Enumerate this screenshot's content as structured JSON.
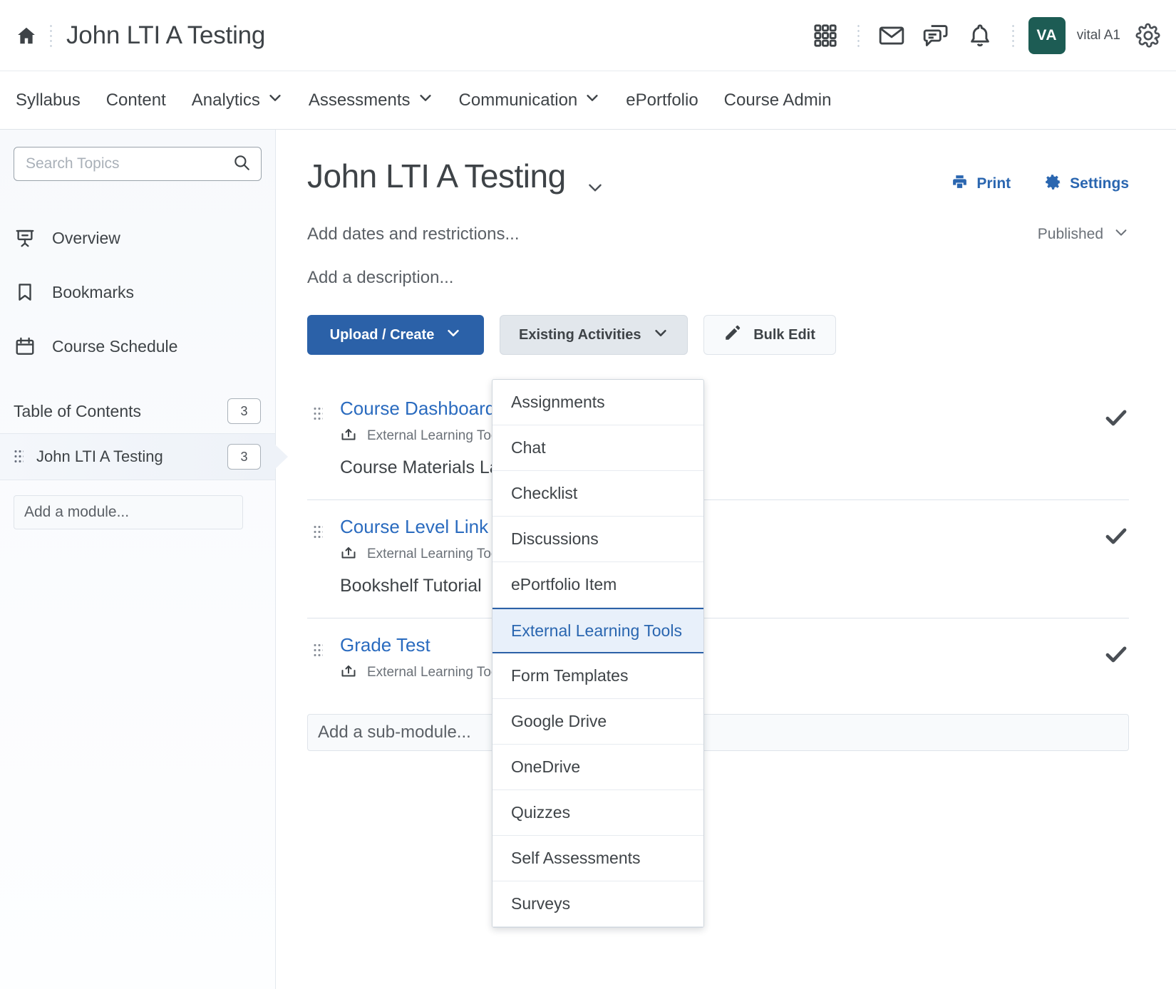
{
  "topbar": {
    "home_icon": "home-icon",
    "title": "John LTI A Testing",
    "icons": [
      {
        "name": "waffle-grid-icon"
      },
      {
        "name": "email-icon"
      },
      {
        "name": "message-icon"
      },
      {
        "name": "bell-icon"
      }
    ],
    "avatar_initials": "VA",
    "username": "vital A1",
    "settings_icon": "gear-icon"
  },
  "nav": {
    "items": [
      {
        "label": "Syllabus",
        "has_chevron": false
      },
      {
        "label": "Content",
        "has_chevron": false
      },
      {
        "label": "Analytics",
        "has_chevron": true
      },
      {
        "label": "Assessments",
        "has_chevron": true
      },
      {
        "label": "Communication",
        "has_chevron": true
      },
      {
        "label": "ePortfolio",
        "has_chevron": false
      },
      {
        "label": "Course Admin",
        "has_chevron": false
      }
    ]
  },
  "sidebar": {
    "search": {
      "value": "",
      "placeholder": "Search Topics",
      "icon": "search-icon"
    },
    "items": [
      {
        "label": "Overview",
        "icon": "presentation-icon"
      },
      {
        "label": "Bookmarks",
        "icon": "bookmark-icon"
      },
      {
        "label": "Course Schedule",
        "icon": "calendar-icon"
      }
    ],
    "toc": {
      "label": "Table of Contents",
      "count": "3"
    },
    "module": {
      "label": "John LTI A Testing",
      "count": "3"
    },
    "add_module": {
      "label": "Add a module...",
      "placeholder": "Add a module..."
    }
  },
  "main": {
    "title": "John LTI A Testing",
    "title_chevron": "chevron-down-icon",
    "print": {
      "label": "Print",
      "icon": "printer-icon"
    },
    "settings": {
      "label": "Settings",
      "icon": "gear-icon"
    },
    "dates_line": "Add dates and restrictions...",
    "description_line": "Add a description...",
    "publish_state": {
      "label": "Published",
      "icon": "chevron-down-icon"
    },
    "buttons": [
      {
        "label": "Upload / Create",
        "style": "primary",
        "icon": "chevron-down-icon"
      },
      {
        "label": "Existing Activities",
        "style": "grey",
        "icon": "chevron-down-icon"
      },
      {
        "label": "Bulk Edit",
        "style": "light",
        "icon": "pencil-icon"
      }
    ],
    "topics": [
      {
        "title": "Course Dashboard Launch",
        "type_label": "External Learning Tool",
        "type_icon": "lti-launch-icon",
        "description": "Course Materials Launch",
        "status_icon": "check-icon"
      },
      {
        "title": "Course Level Link",
        "type_label": "External Learning Tool",
        "type_icon": "lti-launch-icon",
        "description": "Bookshelf Tutorial",
        "status_icon": "check-icon"
      },
      {
        "title": "Grade Test",
        "type_label": "External Learning Tool",
        "type_icon": "lti-launch-icon",
        "description": "",
        "status_icon": "check-icon"
      }
    ],
    "add_sub_module": {
      "label": "Add a sub-module...",
      "placeholder": "Add a sub-module..."
    }
  },
  "dropdown": {
    "items": [
      {
        "label": "Assignments",
        "active": false
      },
      {
        "label": "Chat",
        "active": false
      },
      {
        "label": "Checklist",
        "active": false
      },
      {
        "label": "Discussions",
        "active": false
      },
      {
        "label": "ePortfolio Item",
        "active": false
      },
      {
        "label": "External Learning Tools",
        "active": true
      },
      {
        "label": "Form Templates",
        "active": false
      },
      {
        "label": "Google Drive",
        "active": false
      },
      {
        "label": "OneDrive",
        "active": false
      },
      {
        "label": "Quizzes",
        "active": false
      },
      {
        "label": "Self Assessments",
        "active": false
      },
      {
        "label": "Surveys",
        "active": false
      }
    ]
  },
  "colors": {
    "primary_blue": "#2b61a8",
    "link_blue": "#2a6bbf",
    "avatar_green": "#1d5c54",
    "text_dark": "#3e4347",
    "highlight_bg": "#e8f0fa"
  }
}
